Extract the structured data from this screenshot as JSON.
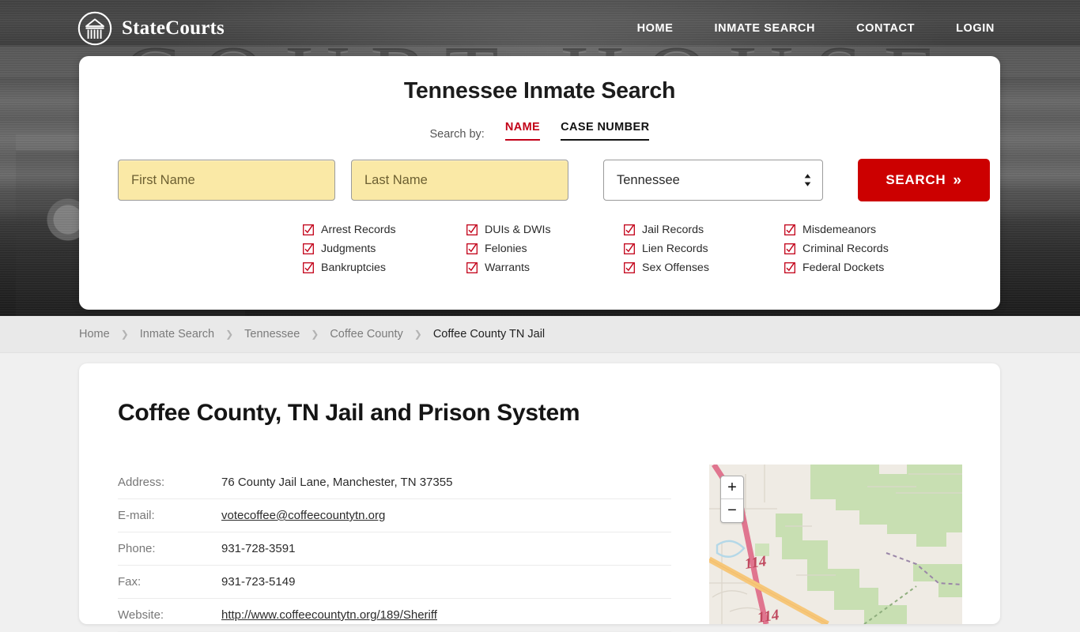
{
  "header": {
    "brand_name": "StateCourts",
    "logo_icon": "courthouse-circle-icon",
    "nav": [
      {
        "label": "HOME"
      },
      {
        "label": "INMATE SEARCH"
      },
      {
        "label": "CONTACT"
      },
      {
        "label": "LOGIN"
      }
    ],
    "background_text": "COURT HOUSE"
  },
  "search": {
    "title": "Tennessee Inmate Search",
    "search_by_label": "Search by:",
    "tabs": [
      {
        "label": "NAME",
        "active": true
      },
      {
        "label": "CASE NUMBER",
        "active": false
      }
    ],
    "first_name_placeholder": "First Name",
    "first_name_value": "",
    "last_name_placeholder": "Last Name",
    "last_name_value": "",
    "state_selected": "Tennessee",
    "state_options": [
      "Tennessee"
    ],
    "button_label": "SEARCH",
    "button_chevron": "»",
    "accent_red": "#cc0000",
    "field_yellow": "#fae9a6",
    "checks": [
      "Arrest Records",
      "DUIs & DWIs",
      "Jail Records",
      "Misdemeanors",
      "Judgments",
      "Felonies",
      "Lien Records",
      "Criminal Records",
      "Bankruptcies",
      "Warrants",
      "Sex Offenses",
      "Federal Dockets"
    ]
  },
  "breadcrumb": {
    "separator": "❯",
    "items": [
      {
        "label": "Home",
        "current": false
      },
      {
        "label": "Inmate Search",
        "current": false
      },
      {
        "label": "Tennessee",
        "current": false
      },
      {
        "label": "Coffee County",
        "current": false
      },
      {
        "label": "Coffee County TN Jail",
        "current": true
      }
    ]
  },
  "main": {
    "page_title": "Coffee County, TN Jail and Prison System",
    "info_rows": [
      {
        "key": "Address:",
        "value": "76 County Jail Lane, Manchester, TN 37355",
        "link": false
      },
      {
        "key": "E-mail:",
        "value": "votecoffee@coffeecountytn.org",
        "link": true
      },
      {
        "key": "Phone:",
        "value": "931-728-3591",
        "link": false
      },
      {
        "key": "Fax:",
        "value": "931-723-5149",
        "link": false
      },
      {
        "key": "Website:",
        "value": "http://www.coffeecountytn.org/189/Sheriff",
        "link": true
      }
    ]
  },
  "map": {
    "zoom_in_label": "+",
    "zoom_out_label": "−",
    "road_labels": [
      "114",
      "114"
    ],
    "tile_style": "openstreetmap"
  }
}
